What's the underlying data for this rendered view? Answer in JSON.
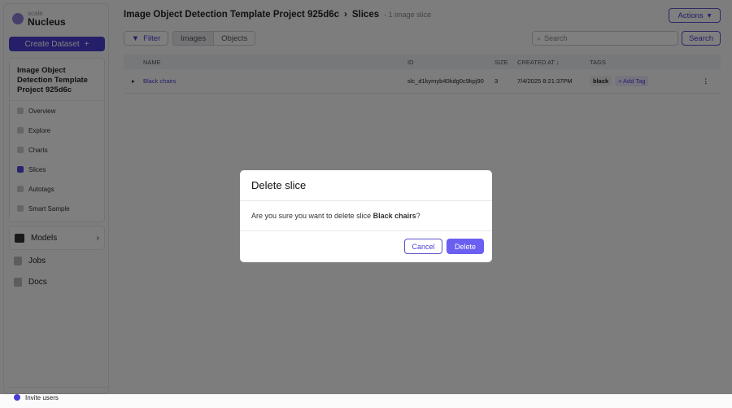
{
  "sidebar": {
    "logo_small": "scale",
    "logo_name": "Nucleus",
    "create_label": "Create Dataset",
    "project_title": "Image Object Detection Template Project 925d6c",
    "nav": [
      {
        "label": "Overview"
      },
      {
        "label": "Explore"
      },
      {
        "label": "Charts"
      },
      {
        "label": "Slices"
      },
      {
        "label": "Autotags"
      },
      {
        "label": "Smart Sample"
      }
    ],
    "models": "Models",
    "jobs": "Jobs",
    "docs": "Docs",
    "invite": "Invite users"
  },
  "header": {
    "project": "Image Object Detection Template Project 925d6c",
    "page": "Slices",
    "count": "- 1 image slice",
    "actions": "Actions"
  },
  "toolbar": {
    "filter": "Filter",
    "tab_images": "Images",
    "tab_objects": "Objects",
    "search_placeholder": "Search",
    "search_button": "Search"
  },
  "table": {
    "headers": {
      "name": "NAME",
      "id": "ID",
      "size": "SIZE",
      "created": "CREATED AT",
      "tags": "TAGS"
    },
    "rows": [
      {
        "name": "Black chairs",
        "id": "slc_d1kymyb40kdg0c9kpj90",
        "size": "3",
        "created": "7/4/2025 8:21:37PM",
        "tag": "black",
        "add_tag": "+ Add Tag"
      }
    ]
  },
  "modal": {
    "title": "Delete slice",
    "prefix": "Are you sure you want to delete slice ",
    "slice": "Black chairs",
    "suffix": "?",
    "cancel": "Cancel",
    "delete": "Delete"
  },
  "colors": {
    "accent": "#4a3fd4"
  }
}
